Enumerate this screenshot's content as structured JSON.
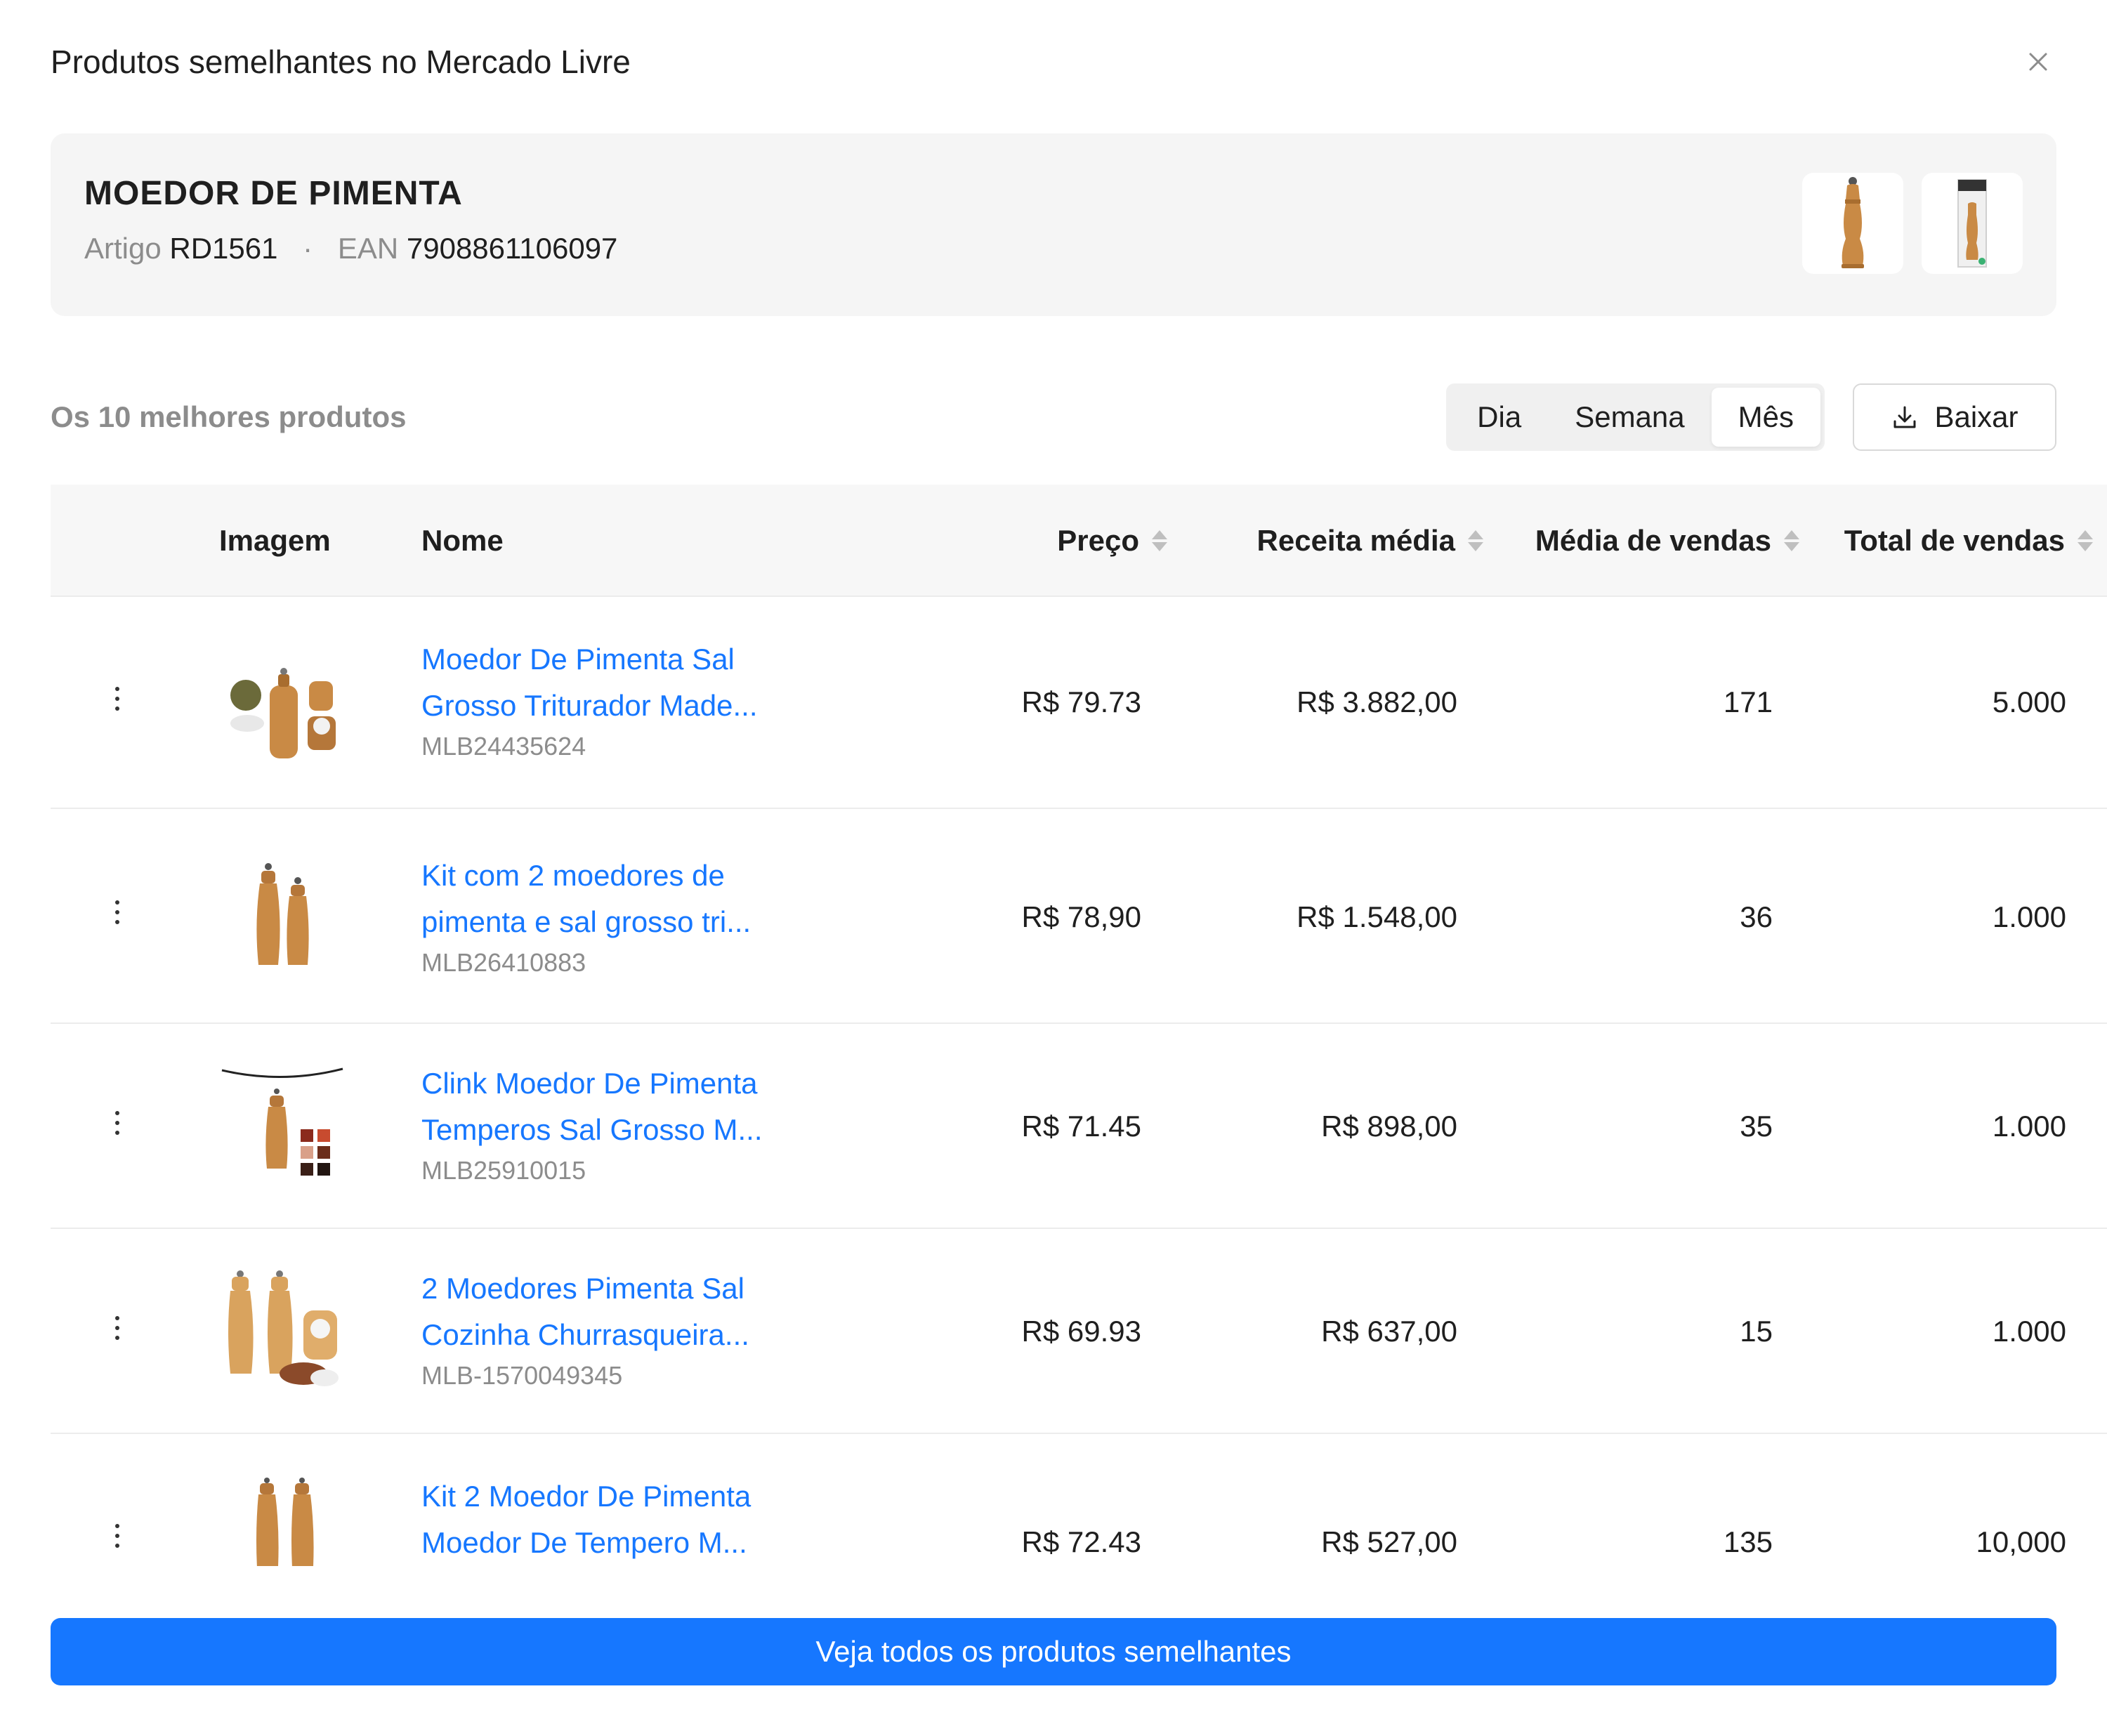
{
  "modal": {
    "title": "Produtos semelhantes no Mercado Livre"
  },
  "product": {
    "name": "MOEDOR DE PIMENTA",
    "article_label": "Artigo",
    "article_value": "RD1561",
    "separator": "·",
    "ean_label": "EAN",
    "ean_value": "7908861106097"
  },
  "toolbar": {
    "section_label": "Os 10 melhores produtos",
    "periods": [
      "Dia",
      "Semana",
      "Mês"
    ],
    "active_period": "Mês",
    "download_label": "Baixar"
  },
  "table": {
    "columns": {
      "image": "Imagem",
      "name": "Nome",
      "price": "Preço",
      "avg_revenue": "Receita média",
      "avg_sales": "Média de vendas",
      "total_sales": "Total de vendas"
    },
    "rows": [
      {
        "name_line1": "Moedor De Pimenta Sal",
        "name_line2": "Grosso Triturador Made...",
        "sku": "MLB24435624",
        "price": "R$ 79.73",
        "avg_revenue": "R$ 3.882,00",
        "avg_sales": "171",
        "total_sales": "5.000"
      },
      {
        "name_line1": "Kit com 2 moedores de",
        "name_line2": "pimenta e sal grosso tri...",
        "sku": "MLB26410883",
        "price": "R$ 78,90",
        "avg_revenue": "R$ 1.548,00",
        "avg_sales": "36",
        "total_sales": "1.000"
      },
      {
        "name_line1": "Clink Moedor De Pimenta",
        "name_line2": "Temperos Sal Grosso M...",
        "sku": "MLB25910015",
        "price": "R$ 71.45",
        "avg_revenue": "R$ 898,00",
        "avg_sales": "35",
        "total_sales": "1.000"
      },
      {
        "name_line1": "2 Moedores Pimenta Sal",
        "name_line2": "Cozinha Churrasqueira...",
        "sku": "MLB-1570049345",
        "price": "R$ 69.93",
        "avg_revenue": "R$ 637,00",
        "avg_sales": "15",
        "total_sales": "1.000"
      },
      {
        "name_line1": "Kit 2 Moedor De Pimenta",
        "name_line2": "Moedor De Tempero M...",
        "sku": "",
        "price": "R$ 72.43",
        "avg_revenue": "R$ 527,00",
        "avg_sales": "135",
        "total_sales": "10,000"
      }
    ]
  },
  "footer": {
    "cta_label": "Veja todos os produtos semelhantes"
  },
  "icons": {
    "close": "close-icon",
    "download": "download-icon",
    "more": "more-vertical-icon",
    "sort": "sort-icon"
  },
  "colors": {
    "accent": "#1677ff",
    "card_bg": "#f5f5f5",
    "muted_text": "#8c8c8c",
    "wood": "#c98a45"
  }
}
